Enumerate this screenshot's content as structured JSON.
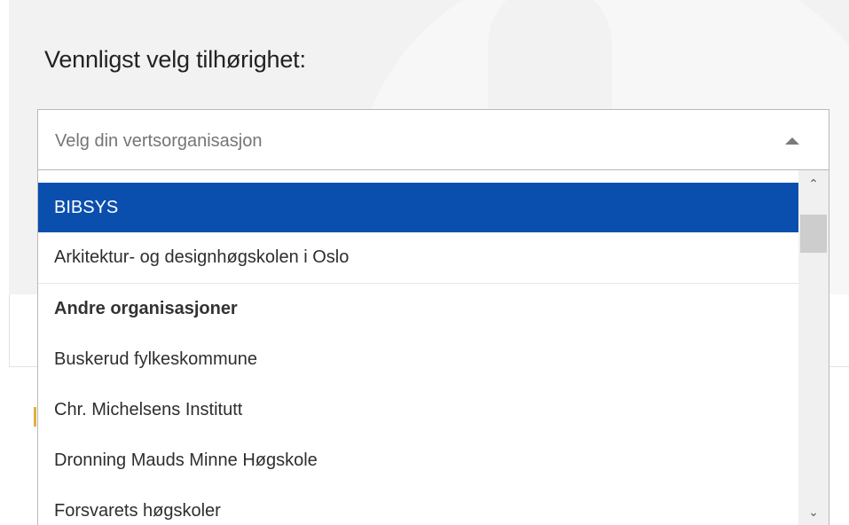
{
  "heading": "Vennligst velg tilhørighet:",
  "select": {
    "placeholder": "Velg din vertsorganisasjon",
    "caret_icon": "caret-up-icon"
  },
  "dropdown": {
    "options": [
      {
        "label": "BIBSYS",
        "selected": true
      },
      {
        "label": "Arkitektur- og designhøgskolen i Oslo"
      },
      {
        "label": "Andre organisasjoner",
        "group": true
      },
      {
        "label": "Buskerud fylkeskommune"
      },
      {
        "label": "Chr. Michelsens Institutt"
      },
      {
        "label": "Dronning Mauds Minne Høgskole"
      },
      {
        "label": "Forsvarets høgskoler"
      }
    ],
    "scroll_up_glyph": "⌃",
    "scroll_down_glyph": "⌄"
  },
  "colors": {
    "selected_bg": "#0b4fae",
    "panel_bg": "#f2f2f2"
  }
}
